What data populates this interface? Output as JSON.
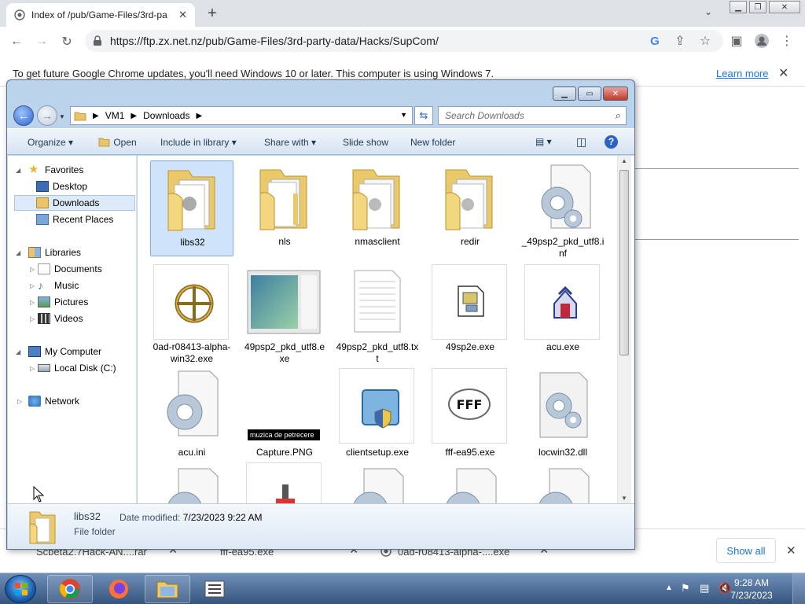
{
  "browser": {
    "tab_title": "Index of /pub/Game-Files/3rd-pa",
    "url": "https://ftp.zx.net.nz/pub/Game-Files/3rd-party-data/Hacks/SupCom/",
    "infobar_message": "To get future Google Chrome updates, you'll need Windows 10 or later. This computer is using Windows 7.",
    "infobar_link": "Learn more"
  },
  "downloads_bar": {
    "items": [
      {
        "label": "Scbeta2.7Hack-AN....rar"
      },
      {
        "label": "fff-ea95.exe"
      },
      {
        "label": "0ad-r08413-alpha-....exe"
      }
    ],
    "show_all": "Show all"
  },
  "explorer": {
    "breadcrumb": [
      "VM1",
      "Downloads"
    ],
    "search_placeholder": "Search Downloads",
    "commands": [
      "Organize",
      "Open",
      "Include in library",
      "Share with",
      "Slide show",
      "New folder"
    ],
    "nav": {
      "favorites": "Favorites",
      "favorites_items": [
        "Desktop",
        "Downloads",
        "Recent Places"
      ],
      "libraries": "Libraries",
      "libraries_items": [
        "Documents",
        "Music",
        "Pictures",
        "Videos"
      ],
      "computer": "My Computer",
      "computer_items": [
        "Local Disk (C:)"
      ],
      "network": "Network"
    },
    "files": [
      {
        "name": "libs32",
        "type": "folder",
        "selected": true
      },
      {
        "name": "nls",
        "type": "folder"
      },
      {
        "name": "nmasclient",
        "type": "folder"
      },
      {
        "name": "redir",
        "type": "folder"
      },
      {
        "name": "_49psp2_pkd_utf8.inf",
        "type": "settings"
      },
      {
        "name": "0ad-r08413-alpha-win32.exe",
        "type": "exe-target"
      },
      {
        "name": "49psp2_pkd_utf8.exe",
        "type": "exe-window"
      },
      {
        "name": "49psp2_pkd_utf8.txt",
        "type": "text"
      },
      {
        "name": "49sp2e.exe",
        "type": "exe-setup"
      },
      {
        "name": "acu.exe",
        "type": "exe-house"
      },
      {
        "name": "acu.ini",
        "type": "settings"
      },
      {
        "name": "Capture.PNG",
        "type": "image",
        "thumb_caption": "muzica de petrecere"
      },
      {
        "name": "clientsetup.exe",
        "type": "exe-shield"
      },
      {
        "name": "fff-ea95.exe",
        "type": "exe-fff",
        "icon_text": "FFF"
      },
      {
        "name": "locwin32.dll",
        "type": "settings"
      }
    ],
    "details": {
      "name": "libs32",
      "type": "File folder",
      "date_label": "Date modified:",
      "date_value": "7/23/2023 9:22 AM"
    }
  },
  "taskbar": {
    "time": "9:28 AM",
    "date": "7/23/2023"
  },
  "colors": {
    "chrome_tabbar": "#dee1e6",
    "explorer_frame": "#bcd3ec",
    "selection": "#cfe3fb",
    "link": "#1a73e8"
  }
}
